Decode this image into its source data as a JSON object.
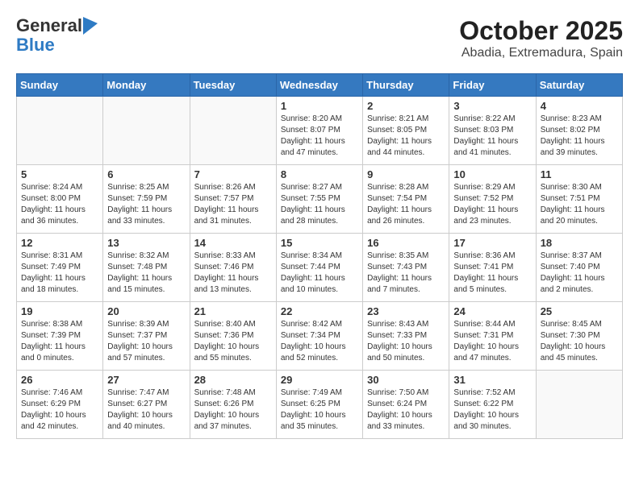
{
  "header": {
    "logo_line1": "General",
    "logo_line2": "Blue",
    "month_title": "October 2025",
    "location": "Abadia, Extremadura, Spain"
  },
  "days_of_week": [
    "Sunday",
    "Monday",
    "Tuesday",
    "Wednesday",
    "Thursday",
    "Friday",
    "Saturday"
  ],
  "weeks": [
    [
      {
        "day": "",
        "info": ""
      },
      {
        "day": "",
        "info": ""
      },
      {
        "day": "",
        "info": ""
      },
      {
        "day": "1",
        "info": "Sunrise: 8:20 AM\nSunset: 8:07 PM\nDaylight: 11 hours and 47 minutes."
      },
      {
        "day": "2",
        "info": "Sunrise: 8:21 AM\nSunset: 8:05 PM\nDaylight: 11 hours and 44 minutes."
      },
      {
        "day": "3",
        "info": "Sunrise: 8:22 AM\nSunset: 8:03 PM\nDaylight: 11 hours and 41 minutes."
      },
      {
        "day": "4",
        "info": "Sunrise: 8:23 AM\nSunset: 8:02 PM\nDaylight: 11 hours and 39 minutes."
      }
    ],
    [
      {
        "day": "5",
        "info": "Sunrise: 8:24 AM\nSunset: 8:00 PM\nDaylight: 11 hours and 36 minutes."
      },
      {
        "day": "6",
        "info": "Sunrise: 8:25 AM\nSunset: 7:59 PM\nDaylight: 11 hours and 33 minutes."
      },
      {
        "day": "7",
        "info": "Sunrise: 8:26 AM\nSunset: 7:57 PM\nDaylight: 11 hours and 31 minutes."
      },
      {
        "day": "8",
        "info": "Sunrise: 8:27 AM\nSunset: 7:55 PM\nDaylight: 11 hours and 28 minutes."
      },
      {
        "day": "9",
        "info": "Sunrise: 8:28 AM\nSunset: 7:54 PM\nDaylight: 11 hours and 26 minutes."
      },
      {
        "day": "10",
        "info": "Sunrise: 8:29 AM\nSunset: 7:52 PM\nDaylight: 11 hours and 23 minutes."
      },
      {
        "day": "11",
        "info": "Sunrise: 8:30 AM\nSunset: 7:51 PM\nDaylight: 11 hours and 20 minutes."
      }
    ],
    [
      {
        "day": "12",
        "info": "Sunrise: 8:31 AM\nSunset: 7:49 PM\nDaylight: 11 hours and 18 minutes."
      },
      {
        "day": "13",
        "info": "Sunrise: 8:32 AM\nSunset: 7:48 PM\nDaylight: 11 hours and 15 minutes."
      },
      {
        "day": "14",
        "info": "Sunrise: 8:33 AM\nSunset: 7:46 PM\nDaylight: 11 hours and 13 minutes."
      },
      {
        "day": "15",
        "info": "Sunrise: 8:34 AM\nSunset: 7:44 PM\nDaylight: 11 hours and 10 minutes."
      },
      {
        "day": "16",
        "info": "Sunrise: 8:35 AM\nSunset: 7:43 PM\nDaylight: 11 hours and 7 minutes."
      },
      {
        "day": "17",
        "info": "Sunrise: 8:36 AM\nSunset: 7:41 PM\nDaylight: 11 hours and 5 minutes."
      },
      {
        "day": "18",
        "info": "Sunrise: 8:37 AM\nSunset: 7:40 PM\nDaylight: 11 hours and 2 minutes."
      }
    ],
    [
      {
        "day": "19",
        "info": "Sunrise: 8:38 AM\nSunset: 7:39 PM\nDaylight: 11 hours and 0 minutes."
      },
      {
        "day": "20",
        "info": "Sunrise: 8:39 AM\nSunset: 7:37 PM\nDaylight: 10 hours and 57 minutes."
      },
      {
        "day": "21",
        "info": "Sunrise: 8:40 AM\nSunset: 7:36 PM\nDaylight: 10 hours and 55 minutes."
      },
      {
        "day": "22",
        "info": "Sunrise: 8:42 AM\nSunset: 7:34 PM\nDaylight: 10 hours and 52 minutes."
      },
      {
        "day": "23",
        "info": "Sunrise: 8:43 AM\nSunset: 7:33 PM\nDaylight: 10 hours and 50 minutes."
      },
      {
        "day": "24",
        "info": "Sunrise: 8:44 AM\nSunset: 7:31 PM\nDaylight: 10 hours and 47 minutes."
      },
      {
        "day": "25",
        "info": "Sunrise: 8:45 AM\nSunset: 7:30 PM\nDaylight: 10 hours and 45 minutes."
      }
    ],
    [
      {
        "day": "26",
        "info": "Sunrise: 7:46 AM\nSunset: 6:29 PM\nDaylight: 10 hours and 42 minutes."
      },
      {
        "day": "27",
        "info": "Sunrise: 7:47 AM\nSunset: 6:27 PM\nDaylight: 10 hours and 40 minutes."
      },
      {
        "day": "28",
        "info": "Sunrise: 7:48 AM\nSunset: 6:26 PM\nDaylight: 10 hours and 37 minutes."
      },
      {
        "day": "29",
        "info": "Sunrise: 7:49 AM\nSunset: 6:25 PM\nDaylight: 10 hours and 35 minutes."
      },
      {
        "day": "30",
        "info": "Sunrise: 7:50 AM\nSunset: 6:24 PM\nDaylight: 10 hours and 33 minutes."
      },
      {
        "day": "31",
        "info": "Sunrise: 7:52 AM\nSunset: 6:22 PM\nDaylight: 10 hours and 30 minutes."
      },
      {
        "day": "",
        "info": ""
      }
    ]
  ]
}
